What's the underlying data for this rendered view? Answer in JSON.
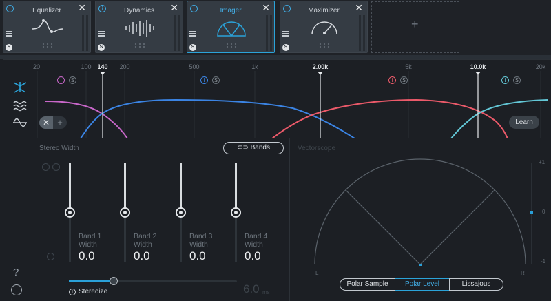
{
  "modules": [
    {
      "title": "Equalizer",
      "icon": "eq-curve-icon",
      "close": "✕",
      "solo": "S"
    },
    {
      "title": "Dynamics",
      "icon": "dynamics-waveform-icon",
      "close": "✕",
      "solo": "S"
    },
    {
      "title": "Imager",
      "icon": "imager-fan-icon",
      "close": "✕",
      "solo": "S",
      "active": true
    },
    {
      "title": "Maximizer",
      "icon": "gauge-icon",
      "close": "✕",
      "solo": "S"
    }
  ],
  "add_module": "+",
  "freq_scale": [
    "20",
    "100",
    "200",
    "500",
    "1k",
    "5k",
    "20k"
  ],
  "crossovers": [
    "140",
    "2.00k",
    "10.0k"
  ],
  "band_controls": {
    "info": "i",
    "solo": "S"
  },
  "band_colors": [
    "#c867c9",
    "#3b84e4",
    "#ec5a6a",
    "#63c7d6"
  ],
  "learn_label": "Learn",
  "xplus": {
    "x": "✕",
    "plus": "+"
  },
  "stereo_width": {
    "title": "Stereo Width",
    "bands_button": "Bands",
    "bands": [
      {
        "name": "Band 1",
        "param": "Width",
        "value": "0.0"
      },
      {
        "name": "Band 2",
        "param": "Width",
        "value": "0.0"
      },
      {
        "name": "Band 3",
        "param": "Width",
        "value": "0.0"
      },
      {
        "name": "Band 4",
        "param": "Width",
        "value": "0.0"
      }
    ],
    "stereoize_info": "i",
    "stereoize_label": "Stereoize",
    "stereoize_amount": 0.26,
    "delay_value": "6.0",
    "delay_unit": "ms"
  },
  "vectorscope": {
    "title": "Vectorscope",
    "left": "L",
    "right": "R",
    "scale": [
      "+1",
      "0",
      "-1"
    ],
    "modes": [
      "Polar Sample",
      "Polar Level",
      "Lissajous"
    ],
    "selected_mode": "Polar Level"
  },
  "sidebar": {
    "help": "?"
  }
}
